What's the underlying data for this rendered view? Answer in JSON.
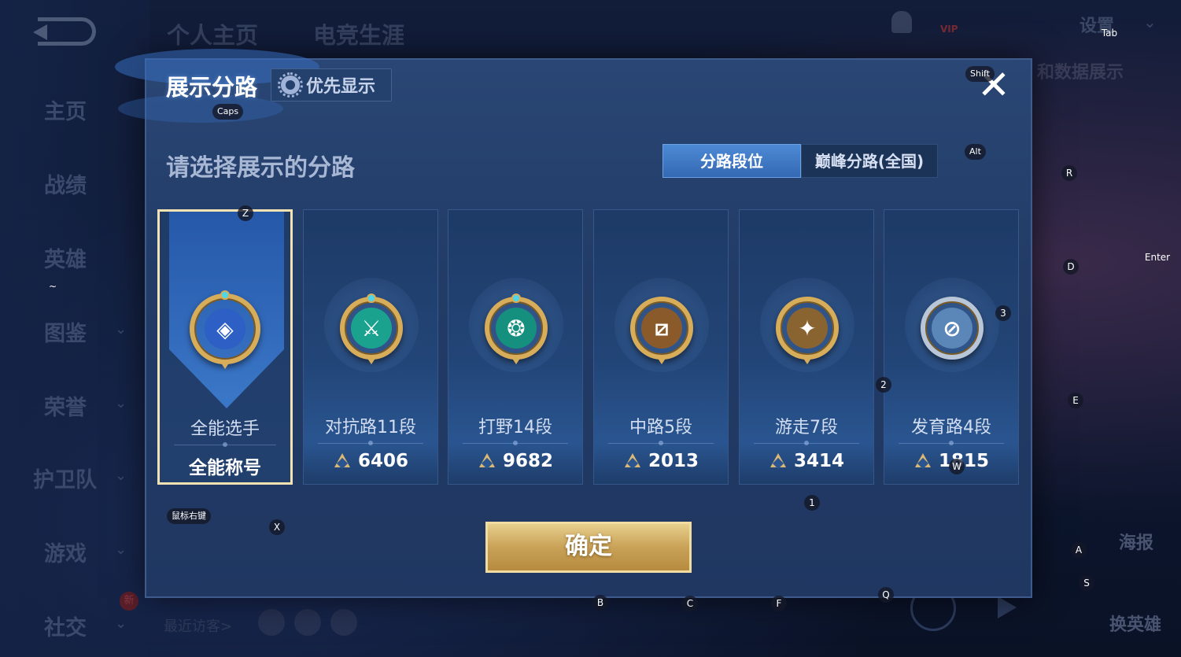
{
  "background": {
    "top_tabs": [
      "个人主页",
      "电竞生涯"
    ],
    "sidebar": [
      {
        "label": "主页",
        "chevron": false
      },
      {
        "label": "战绩",
        "chevron": false
      },
      {
        "label": "英雄",
        "chevron": false
      },
      {
        "label": "图鉴",
        "chevron": true
      },
      {
        "label": "荣誉",
        "chevron": true
      },
      {
        "label": "护卫队",
        "chevron": true
      },
      {
        "label": "游戏",
        "chevron": true
      },
      {
        "label": "社交",
        "chevron": true
      }
    ],
    "top_right": {
      "vip": "VIP",
      "settings": "设置"
    },
    "right_promo": "和数据展示",
    "poster": "海报",
    "swap_hero": "换英雄",
    "recent_visitors": "最近访客>",
    "new_badge": "新"
  },
  "modal": {
    "title": "展示分路",
    "priority_button": "优先显示",
    "close": "✕",
    "subtitle": "请选择展示的分路",
    "segments": [
      "分路段位",
      "巅峰分路(全国)"
    ],
    "active_segment": 0,
    "cards": [
      {
        "name": "全能选手",
        "value": "全能称号",
        "selected": true,
        "emblem_icon": "all-round-emblem",
        "emblem_color": "#2d5fc4"
      },
      {
        "name": "对抗路11段",
        "value": "6406",
        "selected": false,
        "emblem_icon": "clash-lane-emblem",
        "emblem_color": "#1aa28e"
      },
      {
        "name": "打野14段",
        "value": "9682",
        "selected": false,
        "emblem_icon": "jungle-emblem",
        "emblem_color": "#16907e"
      },
      {
        "name": "中路5段",
        "value": "2013",
        "selected": false,
        "emblem_icon": "mid-lane-emblem",
        "emblem_color": "#8a5a2a"
      },
      {
        "name": "游走7段",
        "value": "3414",
        "selected": false,
        "emblem_icon": "roam-emblem",
        "emblem_color": "#8a6430"
      },
      {
        "name": "发育路4段",
        "value": "1815",
        "selected": false,
        "emblem_icon": "farm-lane-emblem",
        "emblem_color": "#5a86b8"
      }
    ],
    "confirm": "确定"
  },
  "key_hints": {
    "shift": "Shift",
    "tab": "Tab",
    "caps": "Caps",
    "alt": "Alt",
    "enter": "Enter",
    "z": "Z",
    "x": "X",
    "r": "R",
    "d": "D",
    "e": "E",
    "a": "A",
    "s": "S",
    "b": "B",
    "c": "C",
    "f": "F",
    "q": "Q",
    "w": "W",
    "n1": "1",
    "n2": "2",
    "n3": "3",
    "tilde": "~",
    "right_click": "鼠标右键"
  },
  "colors": {
    "accent": "#3468b2",
    "gold": "#c9a257",
    "selected_border": "#f2e2b4"
  }
}
